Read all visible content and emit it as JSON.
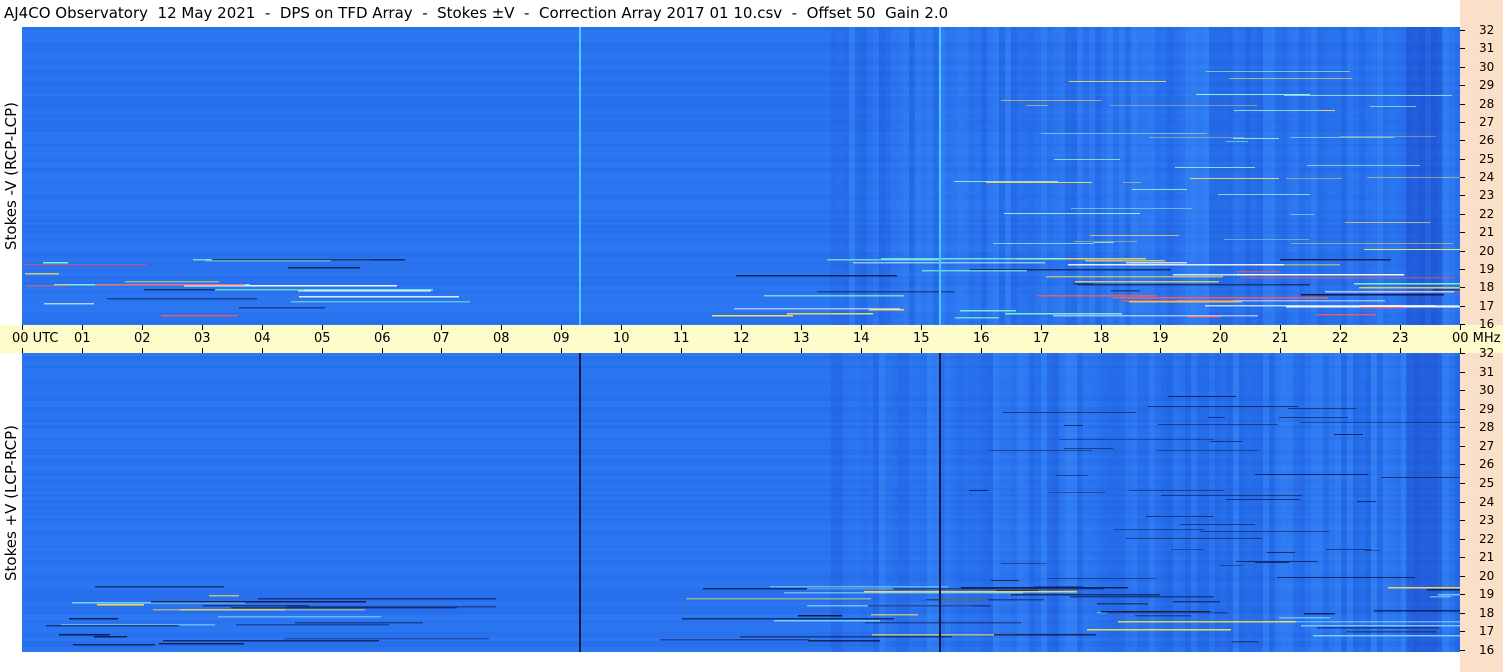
{
  "header": {
    "title": "AJ4CO Observatory  12 May 2021  -  DPS on TFD Array  -  Stokes ±V  -  Correction Array 2017 01 10.csv  -  Offset 50  Gain 2.0"
  },
  "panels": {
    "top_label": "Stokes -V (RCP-LCP)",
    "bottom_label": "Stokes +V (LCP-RCP)"
  },
  "time_axis": {
    "labels": [
      "00",
      "01",
      "02",
      "03",
      "04",
      "05",
      "06",
      "07",
      "08",
      "09",
      "10",
      "11",
      "12",
      "13",
      "14",
      "15",
      "16",
      "17",
      "18",
      "19",
      "20",
      "21",
      "22",
      "23",
      "00"
    ],
    "unit": "UTC",
    "freq_unit": "MHz"
  },
  "freq_axis": {
    "labels": [
      "32",
      "31",
      "30",
      "29",
      "28",
      "27",
      "26",
      "25",
      "24",
      "23",
      "22",
      "21",
      "20",
      "19",
      "18",
      "17",
      "16"
    ]
  },
  "colors": {
    "background_blue": "#2a74f0",
    "time_axis_bg": "#fffccc",
    "freq_axis_bg": "#fbe0c9",
    "dark_line": "#0a1a4a"
  },
  "chart_data": [
    {
      "type": "heatmap",
      "title": "Stokes -V (RCP-LCP)",
      "ylabel": "Stokes -V (RCP-LCP)",
      "x": [
        "00",
        "01",
        "02",
        "03",
        "04",
        "05",
        "06",
        "07",
        "08",
        "09",
        "10",
        "11",
        "12",
        "13",
        "14",
        "15",
        "16",
        "17",
        "18",
        "19",
        "20",
        "21",
        "22",
        "23",
        "00"
      ],
      "x_unit": "UTC",
      "y_unit": "MHz",
      "ylim": [
        16,
        32
      ],
      "notes": "Dynamic spectrum; bright vertical markers near 09.3 and 15.3 UTC; strong activity 16-18 MHz."
    },
    {
      "type": "heatmap",
      "title": "Stokes +V (LCP-RCP)",
      "ylabel": "Stokes +V (LCP-RCP)",
      "x": [
        "00",
        "01",
        "02",
        "03",
        "04",
        "05",
        "06",
        "07",
        "08",
        "09",
        "10",
        "11",
        "12",
        "13",
        "14",
        "15",
        "16",
        "17",
        "18",
        "19",
        "20",
        "21",
        "22",
        "23",
        "00"
      ],
      "x_unit": "UTC",
      "y_unit": "MHz",
      "ylim": [
        16,
        32
      ],
      "notes": "Dynamic spectrum; dark vertical markers near 09.3 and 15.3 UTC."
    }
  ]
}
